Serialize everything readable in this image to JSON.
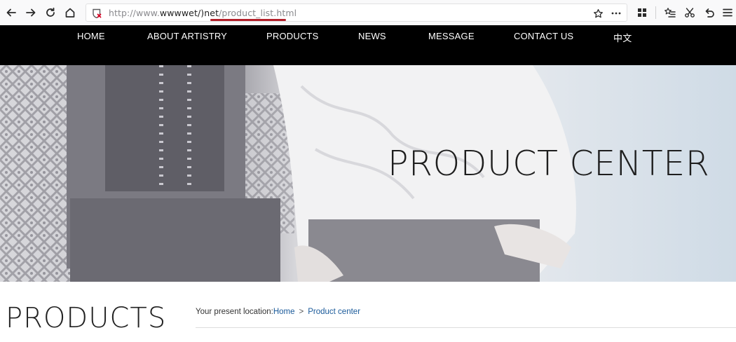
{
  "browser": {
    "url_prefix": "http://www.",
    "url_host": "wwwwet",
    "url_mid": "/)net",
    "url_path": "/product_list.html",
    "icons": [
      "back-icon",
      "forward-icon",
      "reload-icon",
      "home-icon",
      "insecure-shield-icon",
      "bookmark-star-icon",
      "more-icon",
      "apps-grid-icon",
      "reading-list-icon",
      "screenshot-icon",
      "undo-icon",
      "menu-icon"
    ],
    "underline_color": "#b3202a"
  },
  "nav": {
    "items": [
      {
        "label": "HOME"
      },
      {
        "label": "ABOUT ARTISTRY"
      },
      {
        "label": "PRODUCTS"
      },
      {
        "label": "NEWS"
      },
      {
        "label": "MESSAGE"
      },
      {
        "label": "CONTACT US"
      },
      {
        "label": "中文"
      }
    ],
    "background": "#000000"
  },
  "hero": {
    "title": "PRODUCT CENTER"
  },
  "page": {
    "heading": "PRODUCTS",
    "location_label": "Your present location:",
    "breadcrumb": [
      {
        "label": "Home"
      },
      {
        "label": "Product center"
      }
    ],
    "breadcrumb_separator": ">",
    "link_color": "#1a5a9a"
  }
}
